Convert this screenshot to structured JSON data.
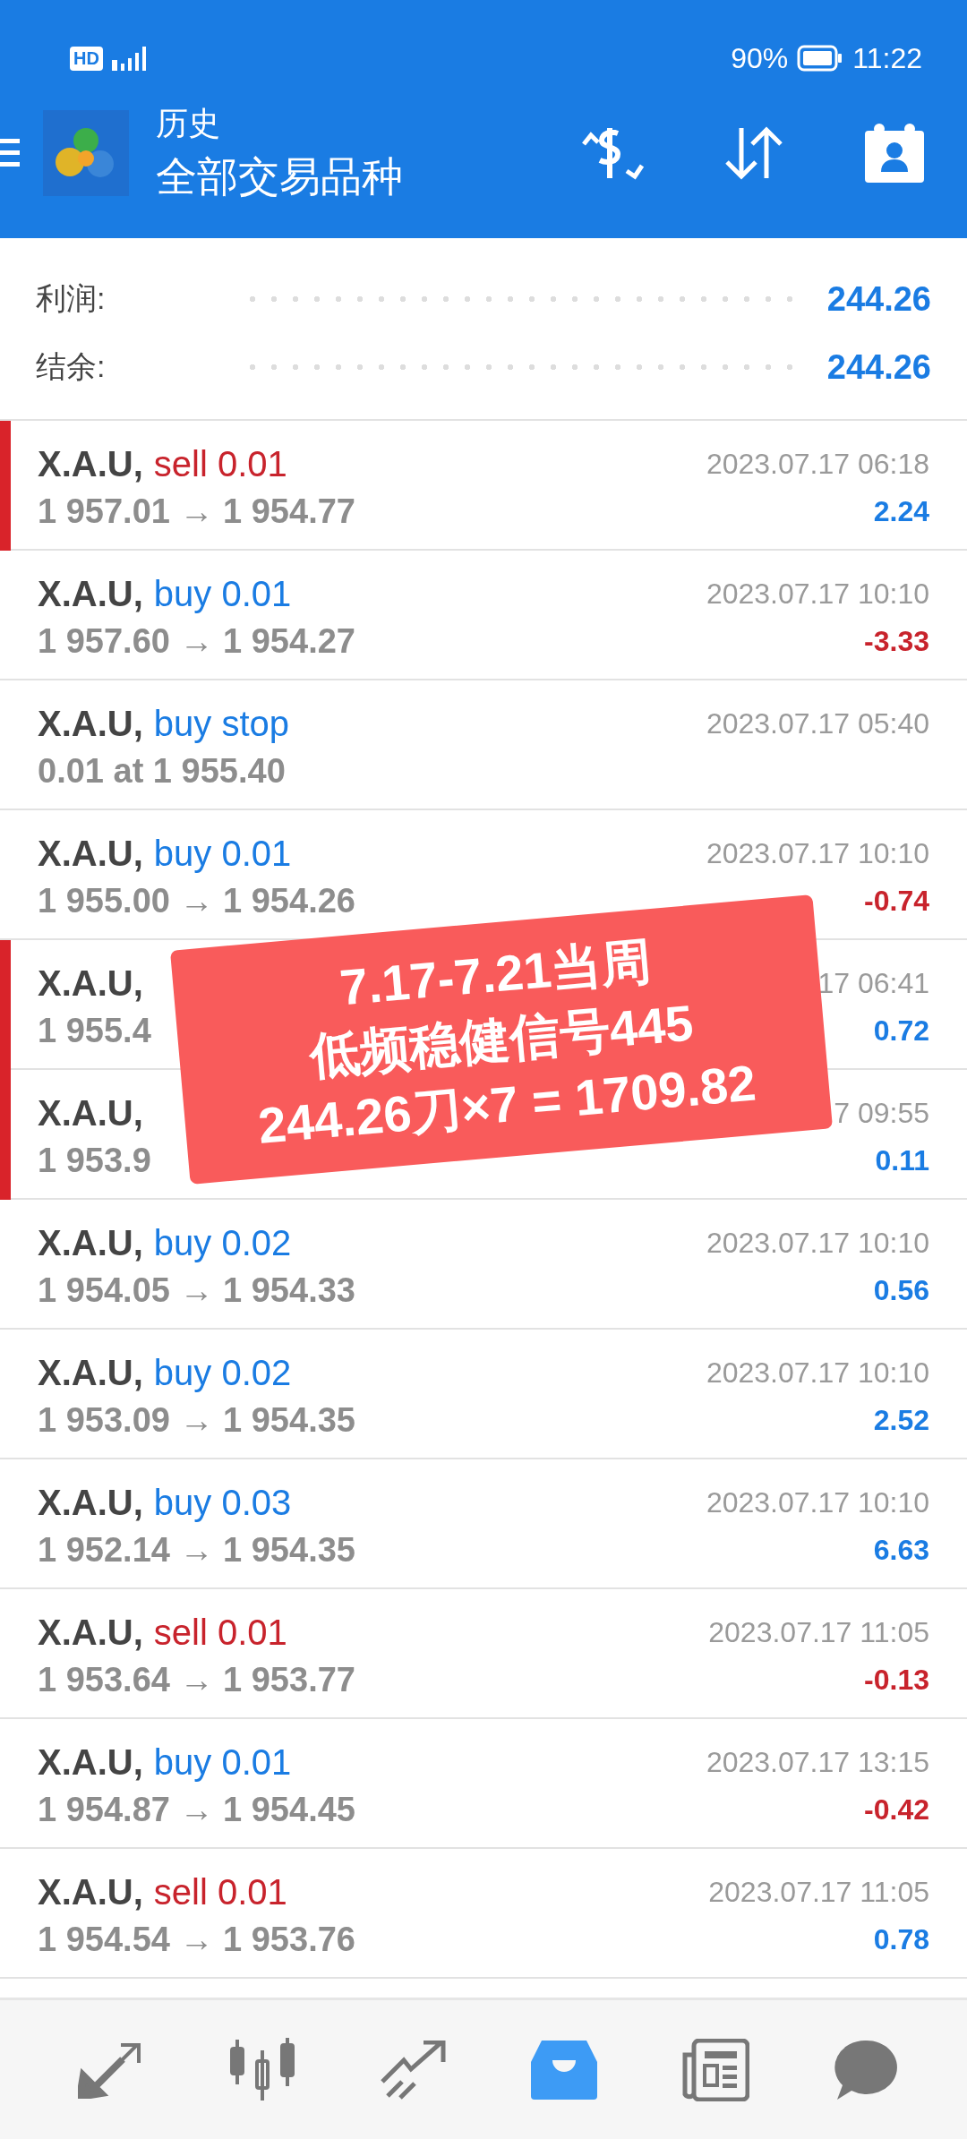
{
  "status_bar": {
    "network": "HD",
    "battery": "90%",
    "time": "11:22"
  },
  "header": {
    "title": "历史",
    "subtitle": "全部交易品种"
  },
  "summary": [
    {
      "label": "利润:",
      "value": "244.26"
    },
    {
      "label": "结余:",
      "value": "244.26"
    }
  ],
  "trades": [
    {
      "symbol": "X.A.U,",
      "side": "sell 0.01",
      "color": "#c8232c",
      "prices": "1 957.01 → 1 954.77",
      "time": "2023.07.17 06:18",
      "profit": "2.24",
      "highlighted": true
    },
    {
      "symbol": "X.A.U,",
      "side": "buy 0.01",
      "color": "#1a7ce3",
      "prices": "1 957.60 → 1 954.27",
      "time": "2023.07.17 10:10",
      "profit": "-3.33",
      "highlighted": false
    },
    {
      "symbol": "X.A.U,",
      "side": "buy stop",
      "color": "#1a7ce3",
      "prices": "0.01 at 1 955.40",
      "time": "2023.07.17 05:40",
      "highlighted": false
    },
    {
      "symbol": "X.A.U,",
      "side": "buy 0.01",
      "color": "#1a7ce3",
      "prices": "1 955.00 → 1 954.26",
      "time": "2023.07.17 10:10",
      "profit": "-0.74",
      "highlighted": false
    },
    {
      "symbol": "X.A.U,",
      "prices": "1 955.4",
      "time": "17 06:41",
      "profit": "0.72",
      "highlighted": true
    },
    {
      "symbol": "X.A.U,",
      "prices": "1 953.9",
      "time": "7 09:55",
      "profit": "0.11",
      "highlighted": true
    },
    {
      "symbol": "X.A.U,",
      "side": "buy 0.02",
      "color": "#1a7ce3",
      "prices": "1 954.05 → 1 954.33",
      "time": "2023.07.17 10:10",
      "profit": "0.56",
      "highlighted": false
    },
    {
      "symbol": "X.A.U,",
      "side": "buy 0.02",
      "color": "#1a7ce3",
      "prices": "1 953.09 → 1 954.35",
      "time": "2023.07.17 10:10",
      "profit": "2.52",
      "highlighted": false
    },
    {
      "symbol": "X.A.U,",
      "side": "buy 0.03",
      "color": "#1a7ce3",
      "prices": "1 952.14 → 1 954.35",
      "time": "2023.07.17 10:10",
      "profit": "6.63",
      "highlighted": false
    },
    {
      "symbol": "X.A.U,",
      "side": "sell 0.01",
      "color": "#c8232c",
      "prices": "1 953.64 → 1 953.77",
      "time": "2023.07.17 11:05",
      "profit": "-0.13",
      "highlighted": false
    },
    {
      "symbol": "X.A.U,",
      "side": "buy 0.01",
      "color": "#1a7ce3",
      "prices": "1 954.87 → 1 954.45",
      "time": "2023.07.17 13:15",
      "profit": "-0.42",
      "highlighted": false
    },
    {
      "symbol": "X.A.U,",
      "side": "sell 0.01",
      "color": "#c8232c",
      "prices": "1 954.54 → 1 953.76",
      "time": "2023.07.17 11:05",
      "profit": "0.78",
      "highlighted": false
    }
  ],
  "sticker": {
    "lines": [
      "7.17-7.21当周",
      "低频稳健信号445",
      "244.26刀×7 = 1709.82"
    ]
  },
  "nav": [
    {
      "kind": "quotes",
      "selected": false
    },
    {
      "kind": "chart",
      "selected": false
    },
    {
      "kind": "trade",
      "selected": false
    },
    {
      "kind": "history",
      "selected": true
    },
    {
      "kind": "news",
      "selected": false
    },
    {
      "kind": "chat",
      "selected": false
    }
  ]
}
